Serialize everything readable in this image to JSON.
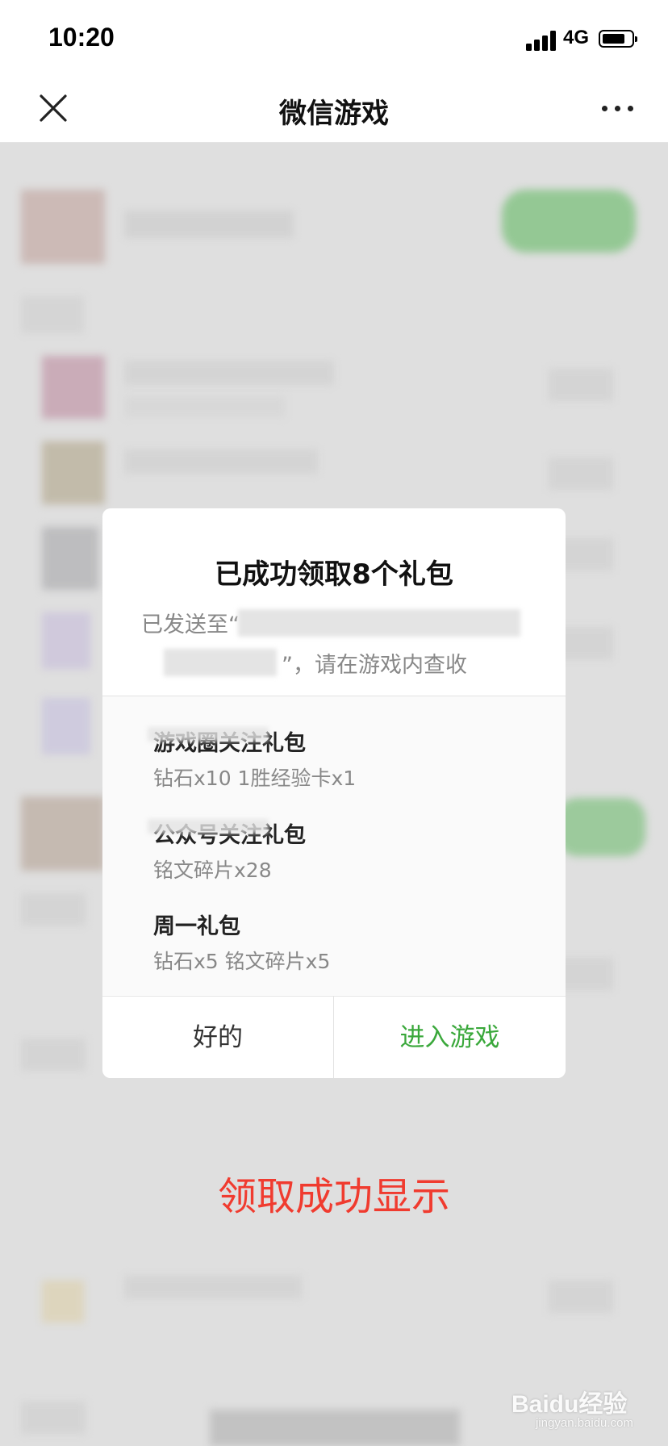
{
  "status_bar": {
    "time": "10:20",
    "network": "4G",
    "battery_level": 0.8,
    "signal_bars": 4
  },
  "nav": {
    "title": "微信游戏",
    "close_icon": "close-icon",
    "more_icon": "more-icon"
  },
  "dialog": {
    "title": "已成功领取8个礼包",
    "subtitle_line1": "已发送至“",
    "subtitle_line2": "”，请在游戏内查收",
    "gifts": [
      {
        "name": "游戏圈关注礼包",
        "detail": "钻石x10 1胜经验卡x1"
      },
      {
        "name": "公众号关注礼包",
        "detail": "铭文碎片x28"
      },
      {
        "name": "周一礼包",
        "detail": "钻石x5 铭文碎片x5"
      }
    ],
    "ok_label": "好的",
    "enter_label": "进入游戏"
  },
  "colors": {
    "accent_green": "#3aa83b",
    "caption_red": "#f03b2f"
  },
  "caption": "领取成功显示",
  "watermark": {
    "main": "Baidu经验",
    "sub": "jingyan.baidu.com"
  }
}
